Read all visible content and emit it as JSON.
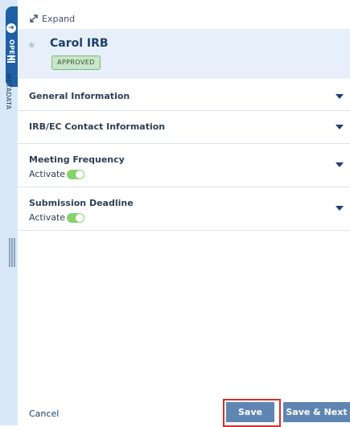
{
  "rail": {
    "open_label": "OPEN",
    "metadata_label": "METADATA"
  },
  "toolbar": {
    "expand_label": "Expand"
  },
  "record": {
    "title": "Carol IRB",
    "status": "APPROVED"
  },
  "sections": [
    {
      "title": "General Information"
    },
    {
      "title": "IRB/EC Contact Information"
    },
    {
      "title": "Meeting Frequency",
      "activate_label": "Activate",
      "activate_on": true
    },
    {
      "title": "Submission Deadline",
      "activate_label": "Activate",
      "activate_on": true
    }
  ],
  "footer": {
    "cancel_label": "Cancel",
    "save_label": "Save",
    "save_next_label": "Save & Next"
  },
  "colors": {
    "primary": "#1f5fa6",
    "button": "#5f86b3",
    "highlight": "#d32f2f",
    "toggle_on": "#86d36c",
    "badge_bg": "#c8e6c9"
  }
}
